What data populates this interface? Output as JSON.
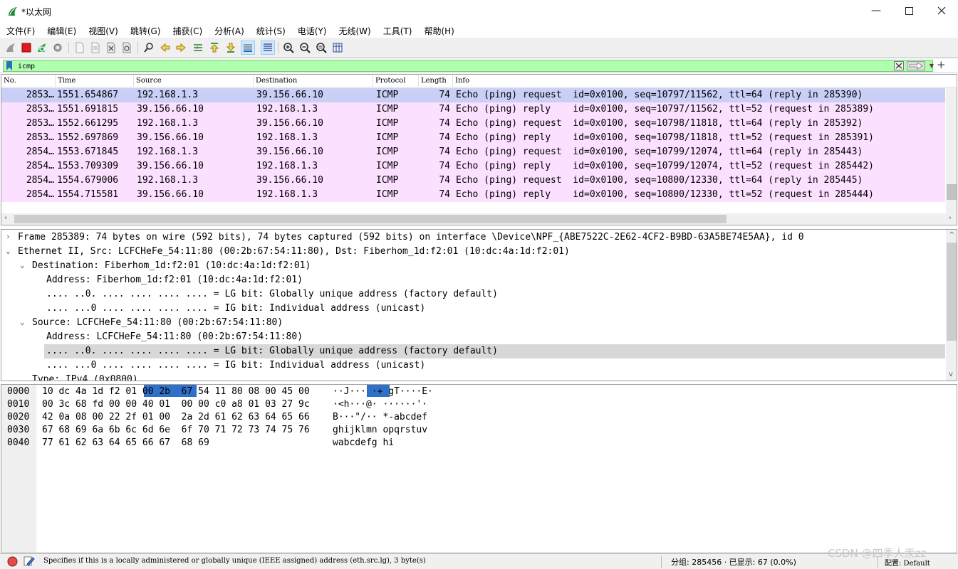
{
  "window": {
    "title": "*以太网"
  },
  "menu": [
    "文件(F)",
    "编辑(E)",
    "视图(V)",
    "跳转(G)",
    "捕获(C)",
    "分析(A)",
    "统计(S)",
    "电话(Y)",
    "无线(W)",
    "工具(T)",
    "帮助(H)"
  ],
  "filter": {
    "value": "icmp"
  },
  "packet_list": {
    "columns": [
      "No.",
      "Time",
      "Source",
      "Destination",
      "Protocol",
      "Length",
      "Info"
    ],
    "rows": [
      {
        "no": "2853…",
        "time": "1551.654867",
        "src": "192.168.1.3",
        "dst": "39.156.66.10",
        "proto": "ICMP",
        "len": "74",
        "info": "Echo (ping) request  id=0x0100, seq=10797/11562, ttl=64 (reply in 285390)"
      },
      {
        "no": "2853…",
        "time": "1551.691815",
        "src": "39.156.66.10",
        "dst": "192.168.1.3",
        "proto": "ICMP",
        "len": "74",
        "info": "Echo (ping) reply    id=0x0100, seq=10797/11562, ttl=52 (request in 285389)"
      },
      {
        "no": "2853…",
        "time": "1552.661295",
        "src": "192.168.1.3",
        "dst": "39.156.66.10",
        "proto": "ICMP",
        "len": "74",
        "info": "Echo (ping) request  id=0x0100, seq=10798/11818, ttl=64 (reply in 285392)"
      },
      {
        "no": "2853…",
        "time": "1552.697869",
        "src": "39.156.66.10",
        "dst": "192.168.1.3",
        "proto": "ICMP",
        "len": "74",
        "info": "Echo (ping) reply    id=0x0100, seq=10798/11818, ttl=52 (request in 285391)"
      },
      {
        "no": "2854…",
        "time": "1553.671845",
        "src": "192.168.1.3",
        "dst": "39.156.66.10",
        "proto": "ICMP",
        "len": "74",
        "info": "Echo (ping) request  id=0x0100, seq=10799/12074, ttl=64 (reply in 285443)"
      },
      {
        "no": "2854…",
        "time": "1553.709309",
        "src": "39.156.66.10",
        "dst": "192.168.1.3",
        "proto": "ICMP",
        "len": "74",
        "info": "Echo (ping) reply    id=0x0100, seq=10799/12074, ttl=52 (request in 285442)"
      },
      {
        "no": "2854…",
        "time": "1554.679006",
        "src": "192.168.1.3",
        "dst": "39.156.66.10",
        "proto": "ICMP",
        "len": "74",
        "info": "Echo (ping) request  id=0x0100, seq=10800/12330, ttl=64 (reply in 285445)"
      },
      {
        "no": "2854…",
        "time": "1554.715581",
        "src": "39.156.66.10",
        "dst": "192.168.1.3",
        "proto": "ICMP",
        "len": "74",
        "info": "Echo (ping) reply    id=0x0100, seq=10800/12330, ttl=52 (request in 285444)"
      }
    ]
  },
  "details": [
    {
      "toggle": "›",
      "text": "Frame 285389: 74 bytes on wire (592 bits), 74 bytes captured (592 bits) on interface \\Device\\NPF_{ABE7522C-2E62-4CF2-B9BD-63A5BE74E5AA}, id 0"
    },
    {
      "toggle": "⌄",
      "text": "Ethernet II, Src: LCFCHeFe_54:11:80 (00:2b:67:54:11:80), Dst: Fiberhom_1d:f2:01 (10:dc:4a:1d:f2:01)"
    },
    {
      "toggle": "⌄",
      "text": "Destination: Fiberhom_1d:f2:01 (10:dc:4a:1d:f2:01)"
    },
    {
      "toggle": "",
      "text": "Address: Fiberhom_1d:f2:01 (10:dc:4a:1d:f2:01)"
    },
    {
      "toggle": "",
      "text": ".... ..0. .... .... .... .... = LG bit: Globally unique address (factory default)"
    },
    {
      "toggle": "",
      "text": ".... ...0 .... .... .... .... = IG bit: Individual address (unicast)"
    },
    {
      "toggle": "⌄",
      "text": "Source: LCFCHeFe_54:11:80 (00:2b:67:54:11:80)"
    },
    {
      "toggle": "",
      "text": "Address: LCFCHeFe_54:11:80 (00:2b:67:54:11:80)"
    },
    {
      "toggle": "",
      "text": ".... ..0. .... .... .... .... = LG bit: Globally unique address (factory default)"
    },
    {
      "toggle": "",
      "text": ".... ...0 .... .... .... .... = IG bit: Individual address (unicast)"
    },
    {
      "toggle": "",
      "text": "Type: IPv4 (0x0800)"
    }
  ],
  "bytes": [
    {
      "offset": "0000",
      "hex": "10 dc 4a 1d f2 01 00 2b  67 54 11 80 08 00 45 00",
      "ascii": "··J··· ·+ gT····E·"
    },
    {
      "offset": "0010",
      "hex": "00 3c 68 fd 00 00 40 01  00 00 c0 a8 01 03 27 9c",
      "ascii": "·<h···@· ······'·"
    },
    {
      "offset": "0020",
      "hex": "42 0a 08 00 22 2f 01 00  2a 2d 61 62 63 64 65 66",
      "ascii": "B···\"/·· *-abcdef"
    },
    {
      "offset": "0030",
      "hex": "67 68 69 6a 6b 6c 6d 6e  6f 70 71 72 73 74 75 76",
      "ascii": "ghijklmn opqrstuv"
    },
    {
      "offset": "0040",
      "hex": "77 61 62 63 64 65 66 67  68 69",
      "ascii": "wabcdefg hi"
    }
  ],
  "status": {
    "message": "Specifies if this is a locally administered or globally unique (IEEE assigned) address (eth.src.lg), 3 byte(s)",
    "packets": "分组: 285456 · 已显示: 67 (0.0%)",
    "profile": "配置: Default"
  },
  "watermark": "CSDN @四季人汞zz",
  "colors": {
    "selected_row": "#c9cff5",
    "icmp_row": "#fce0ff",
    "filter_valid": "#afffaf",
    "byte_highlight": "#2f71c9",
    "detail_highlight": "#d8d8d8"
  }
}
